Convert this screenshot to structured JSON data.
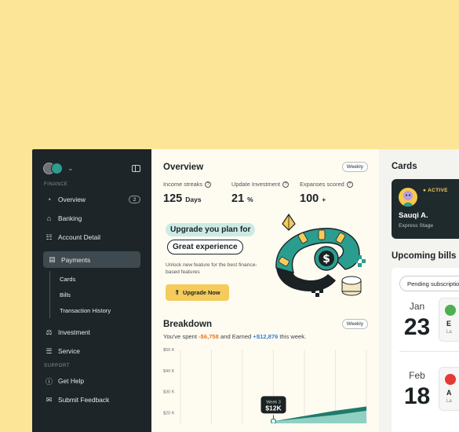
{
  "sidebar": {
    "section_finance": "FINANCE",
    "items": [
      {
        "label": "Overview",
        "icon": "overview-icon",
        "badge": "2"
      },
      {
        "label": "Banking",
        "icon": "bank-icon"
      },
      {
        "label": "Account Detail",
        "icon": "account-detail-icon"
      },
      {
        "label": "Payments",
        "icon": "payments-icon",
        "active": true
      },
      {
        "label": "Investment",
        "icon": "investment-icon"
      },
      {
        "label": "Service",
        "icon": "service-icon"
      }
    ],
    "payments_sub": [
      "Cards",
      "Bills",
      "Transaction History"
    ],
    "section_support": "SUPPORT",
    "support_items": [
      {
        "label": "Get Help",
        "icon": "help-icon"
      },
      {
        "label": "Submit Feedback",
        "icon": "feedback-icon"
      }
    ]
  },
  "overview": {
    "title": "Overview",
    "period": "Weekly",
    "stats": [
      {
        "label": "Income streaks",
        "value": "125",
        "unit": "Days"
      },
      {
        "label": "Update Investment",
        "value": "21",
        "unit": "%"
      },
      {
        "label": "Expanses scored",
        "value": "100",
        "unit": "+"
      }
    ],
    "promo": {
      "line1": "Upgrade you plan for",
      "line2": "Great experience",
      "description": "Unlock new feature for the best finance-based features",
      "button": "Upgrade Now"
    }
  },
  "breakdown": {
    "title": "Breakdown",
    "period": "Weekly",
    "spent_prefix": "You've spent",
    "spent_value": "-$6,758",
    "earned_prefix": "and Earned",
    "earned_value": "+$12,876",
    "suffix": "this week."
  },
  "chart_data": {
    "type": "area",
    "y_tick_labels": [
      "$50 K",
      "$40 K",
      "$30 K",
      "$20 K"
    ],
    "ylim": [
      15,
      50
    ],
    "x": [
      0,
      1,
      2,
      3,
      4,
      5,
      6
    ],
    "series": [
      {
        "values": [
          null,
          null,
          null,
          16,
          18.5,
          21,
          23
        ]
      },
      {
        "values": [
          null,
          null,
          null,
          16,
          17.5,
          19,
          21
        ]
      }
    ],
    "tooltip": {
      "label": "Week 3",
      "value": "$12K"
    },
    "colors": [
      "#1F7A6A",
      "#8FD0C2"
    ]
  },
  "cards": {
    "title": "Cards",
    "status": "ACTIVE",
    "name": "Sauqi A.",
    "stage": "Express Stage"
  },
  "upcoming": {
    "title": "Upcoming bills",
    "filter": "Pending subscription",
    "bills": [
      {
        "month": "Jan",
        "day": "23",
        "name": "E",
        "sub": "La"
      },
      {
        "month": "Feb",
        "day": "18",
        "name": "A",
        "sub": "La"
      }
    ]
  },
  "colors": {
    "background": "#FCE597",
    "sidebar": "#1E2528",
    "accent": "#2A9D8F",
    "button": "#F5CB5C"
  }
}
